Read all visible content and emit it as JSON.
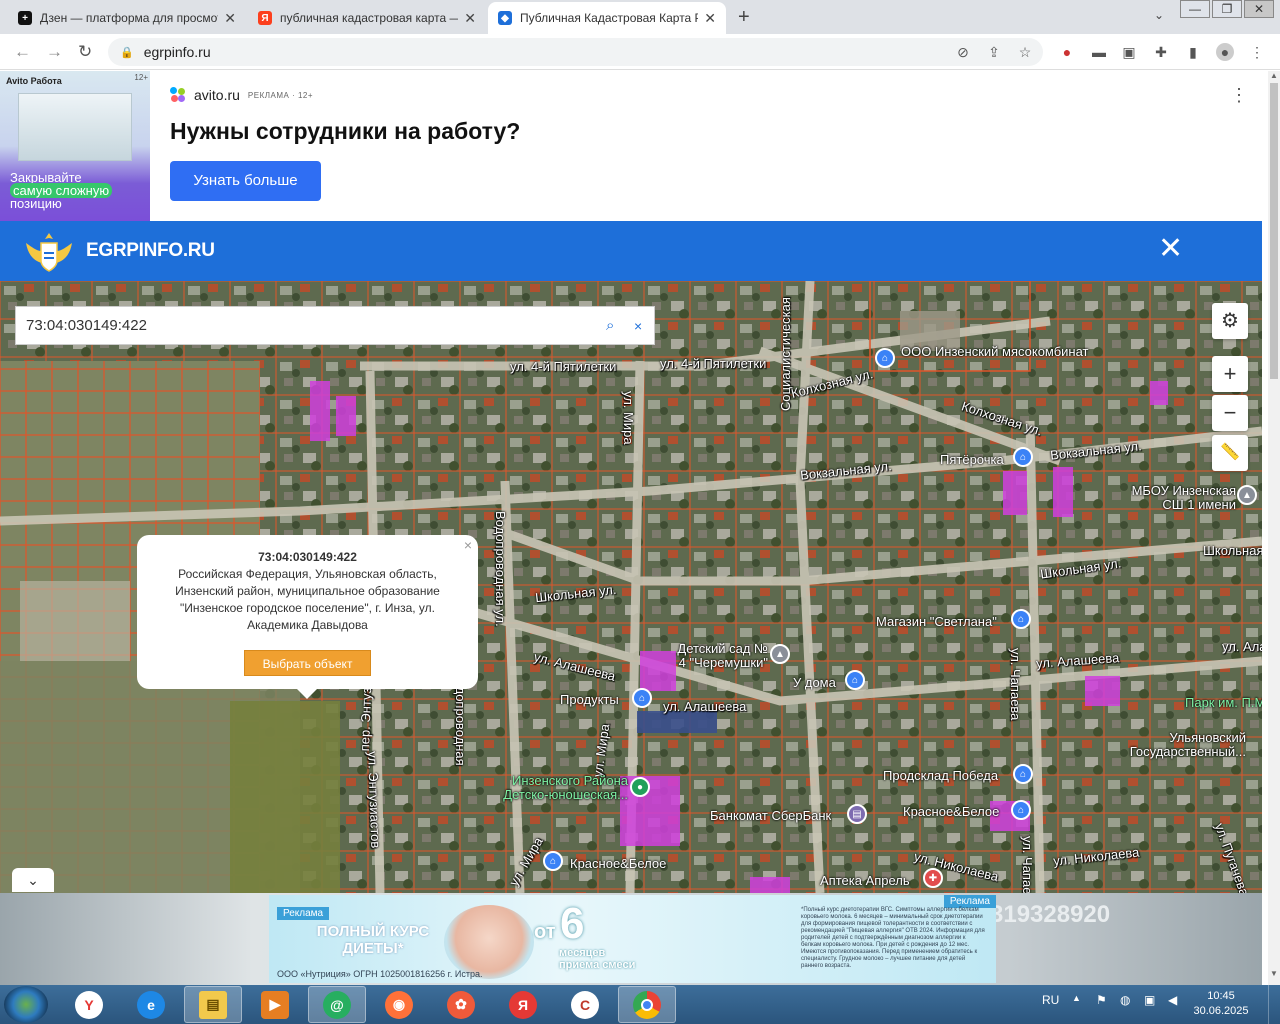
{
  "browser": {
    "tabs": [
      {
        "title": "Дзен — платформа для просмотра",
        "icon": "zen-icon",
        "color": "#111111"
      },
      {
        "title": "публичная кадастровая карта — ",
        "icon": "yandex-icon",
        "color": "#fc3f1d"
      },
      {
        "title": "Публичная Кадастровая Карта Р",
        "icon": "shield-icon",
        "color": "#1e6fd9"
      }
    ],
    "url": "egrpinfo.ru",
    "new_tab": "+",
    "window": {
      "min": "—",
      "max": "❐",
      "close": "✕"
    }
  },
  "ad_top": {
    "avito_logo": "Avito Работа",
    "age": "12+",
    "image_text_1": "Закрывайте",
    "image_text_2": "самую сложную",
    "image_text_3": "позицию",
    "source": "avito.ru",
    "source_tag": "РЕКЛАМА · 12+",
    "headline": "Нужны сотрудники на работу?",
    "button": "Узнать больше",
    "menu": "⋮"
  },
  "site": {
    "brand": "EGRPINFO.RU",
    "close": "✕"
  },
  "map": {
    "search_value": "73:04:030149:422",
    "search_icon": "search-icon",
    "clear": "×",
    "controls": {
      "settings": "⚙",
      "zoom_in": "+",
      "zoom_out": "−",
      "ruler": "ruler-icon"
    },
    "popup": {
      "title": "73:04:030149:422",
      "address": "Российская Федерация, Ульяновская область, Инзенский район, муниципальное образование \"Инзенское городское поселение\", г. Инза, ул. Академика Давыдова",
      "button": "Выбрать объект",
      "close": "×"
    },
    "streets": [
      "ул. 4-й Пятилетки",
      "ул. 4-й Пятилетки",
      "ул. Мира",
      "Колхозная ул.",
      "Колхозная ул.",
      "Вокзальная ул.",
      "Вокзальная ул.",
      "Школьная ул.",
      "Школьная ул.",
      "Школьная ул.",
      "ул. Алашеева",
      "ул. Алашеева",
      "ул. Алашеева",
      "ул. Алашеева",
      "ул. Мира",
      "ул. Чапаева",
      "ул. Энтузиастов",
      "Водопроводная ул.",
      "ул. Николаева",
      "ул. Николаева",
      "ул. Мира",
      "Социалистическая",
      "пер. Энтузиастов",
      "Водопроводная",
      "ул. Чапаева",
      "ул. Пугачева"
    ],
    "pois": [
      "ООО Инзенский мясокомбинат",
      "Пятёрочка",
      "МБОУ Инзенская СШ 1 имени",
      "Магазин \"Светлана\"",
      "Детский сад № 4 \"Черемушки\"",
      "У дома",
      "Продукты",
      "Инзенского Района Детско-юношеская...",
      "Продсклад Победа",
      "Банкомат СберБанк",
      "Красное&Белое",
      "Красное&Белое",
      "Аптека Апрель",
      "Парк им. П.М",
      "Ульяновский Государственный..."
    ],
    "collapse": "⌄"
  },
  "ad_bottom": {
    "tag": "Реклама",
    "tag2": "Реклама",
    "main": "ПОЛНЫЙ КУРС ДИЕТЫ*",
    "from": "от",
    "num": "6",
    "months": "месяцев",
    "mix": "приема смеси",
    "fine": "*Полный курс диетотерапии ВГС. Симптомы аллергии к белкам коровьего молока. 6 месяцев – минимальный срок диетотерапии для формирования пищевой толерантности в соответствии с рекомендацией \"Пищевая аллергия\" ОТВ 2024. Информация для родителей детей с подтверждённым диагнозом аллергии к белкам коровьего молока. При детей с рождения до 12 мес. Имеются противопоказания. Перед применением обратитесь к специалисту. Грудное молоко – лучшее питание для детей раннего возраста.",
    "corp": "ООО «Нутриция» ОГРН 1025001816256 г. Истра.",
    "phone": "319328920"
  },
  "taskbar": {
    "lang": "RU",
    "time": "10:45",
    "date": "30.06.2025"
  }
}
